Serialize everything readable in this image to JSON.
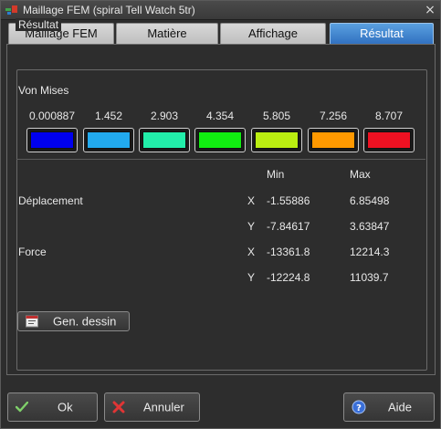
{
  "window": {
    "title": "Maillage FEM (spiral Tell Watch 5tr)",
    "close_glyph": "×"
  },
  "tabs": [
    {
      "label": "Maillage FEM"
    },
    {
      "label": "Matière"
    },
    {
      "label": "Affichage"
    },
    {
      "label": "Résultat",
      "active": true
    }
  ],
  "result": {
    "group_title": "Résultat",
    "von_mises_label": "Von Mises",
    "scale": [
      {
        "value": "0.000887",
        "color": "#0000ee"
      },
      {
        "value": "1.452",
        "color": "#22aaee"
      },
      {
        "value": "2.903",
        "color": "#22eeaa"
      },
      {
        "value": "4.354",
        "color": "#11ee11"
      },
      {
        "value": "5.805",
        "color": "#bbee11"
      },
      {
        "value": "7.256",
        "color": "#ff9900"
      },
      {
        "value": "8.707",
        "color": "#ee1122"
      }
    ],
    "headers": {
      "min": "Min",
      "max": "Max"
    },
    "rows": [
      {
        "label": "Déplacement",
        "axis": "X",
        "min": "-1.55886",
        "max": "6.85498"
      },
      {
        "label": "",
        "axis": "Y",
        "min": "-7.84617",
        "max": "3.63847"
      },
      {
        "label": "Force",
        "axis": "X",
        "min": "-13361.8",
        "max": "12214.3"
      },
      {
        "label": "",
        "axis": "Y",
        "min": "-12224.8",
        "max": "11039.7"
      }
    ],
    "gen_button_label": "Gen. dessin"
  },
  "footer": {
    "ok_label": "Ok",
    "cancel_label": "Annuler",
    "help_label": "Aide"
  },
  "icons": {
    "app": "app-icon",
    "close": "close-icon",
    "gen": "drawing-icon",
    "ok": "checkmark-icon",
    "cancel": "cross-icon",
    "help": "help-icon"
  },
  "colors": {
    "active_tab": "#3f84d0",
    "ok_check": "#7fd06a",
    "cancel_cross": "#e03535",
    "help_circle": "#3a6fd8"
  }
}
